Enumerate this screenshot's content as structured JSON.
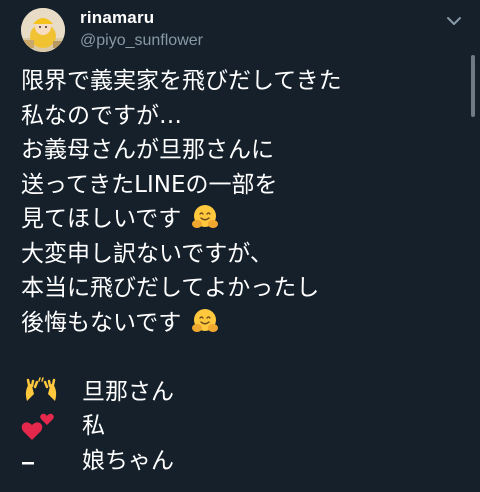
{
  "user": {
    "display_name": "rinamaru",
    "handle": "@piyo_sunflower",
    "avatar_icon": "profile-photo-yellow-hat",
    "menu_icon": "chevron-down-icon"
  },
  "tweet": {
    "lines": [
      "限界で義実家を飛びだしてきた",
      "私なのですが…",
      "お義母さんが旦那さんに",
      "送ってきたLINEの一部を",
      "見てほしいです",
      "大変申し訳ないですが、",
      "本当に飛びだしてよかったし",
      "後悔もないです"
    ],
    "emoji": "hugging-face-emoji"
  },
  "legend": [
    {
      "icon": "raising-hands-emoji",
      "label": "旦那さん"
    },
    {
      "icon": "two-hearts-emoji",
      "label": "私"
    },
    {
      "icon": "dash-mark",
      "label": "娘ちゃん"
    }
  ],
  "colors": {
    "background": "#15202b",
    "text": "#ffffff",
    "secondary_text": "#8899a6"
  }
}
